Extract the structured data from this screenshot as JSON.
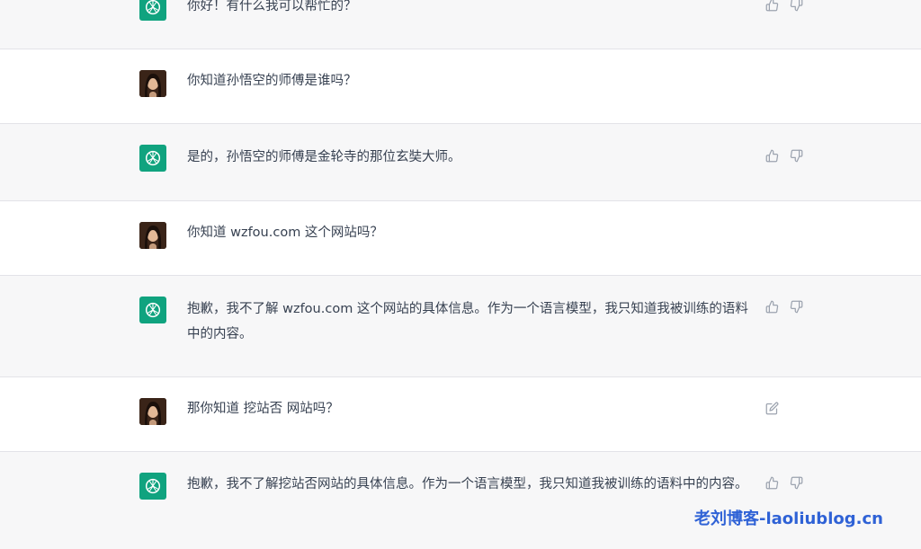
{
  "conversation": [
    {
      "role": "assistant",
      "text": "你好！有什么我可以帮忙的？",
      "actions": [
        "thumbs-up",
        "thumbs-down"
      ]
    },
    {
      "role": "user",
      "text": "你知道孙悟空的师傅是谁吗？",
      "actions": []
    },
    {
      "role": "assistant",
      "text": "是的，孙悟空的师傅是金轮寺的那位玄奘大师。",
      "actions": [
        "thumbs-up",
        "thumbs-down"
      ]
    },
    {
      "role": "user",
      "text": "你知道 wzfou.com 这个网站吗？",
      "actions": []
    },
    {
      "role": "assistant",
      "text": "抱歉，我不了解 wzfou.com 这个网站的具体信息。作为一个语言模型，我只知道我被训练的语料中的内容。",
      "actions": [
        "thumbs-up",
        "thumbs-down"
      ]
    },
    {
      "role": "user",
      "text": "那你知道 挖站否 网站吗？",
      "actions": [
        "edit"
      ]
    },
    {
      "role": "assistant",
      "text": "抱歉，我不了解挖站否网站的具体信息。作为一个语言模型，我只知道我被训练的语料中的内容。",
      "actions": [
        "thumbs-up",
        "thumbs-down"
      ]
    }
  ],
  "watermark": "老刘博客-laoliublog.cn",
  "colors": {
    "assistant_bg": "#f7f7f8",
    "user_bg": "#ffffff",
    "bot_avatar": "#10a37f",
    "watermark": "#2f62d6"
  },
  "icons": {
    "bot_avatar": "openai-logo-icon",
    "user_avatar": "user-avatar-photo",
    "thumbs_up": "thumbs-up-icon",
    "thumbs_down": "thumbs-down-icon",
    "edit": "edit-icon"
  }
}
